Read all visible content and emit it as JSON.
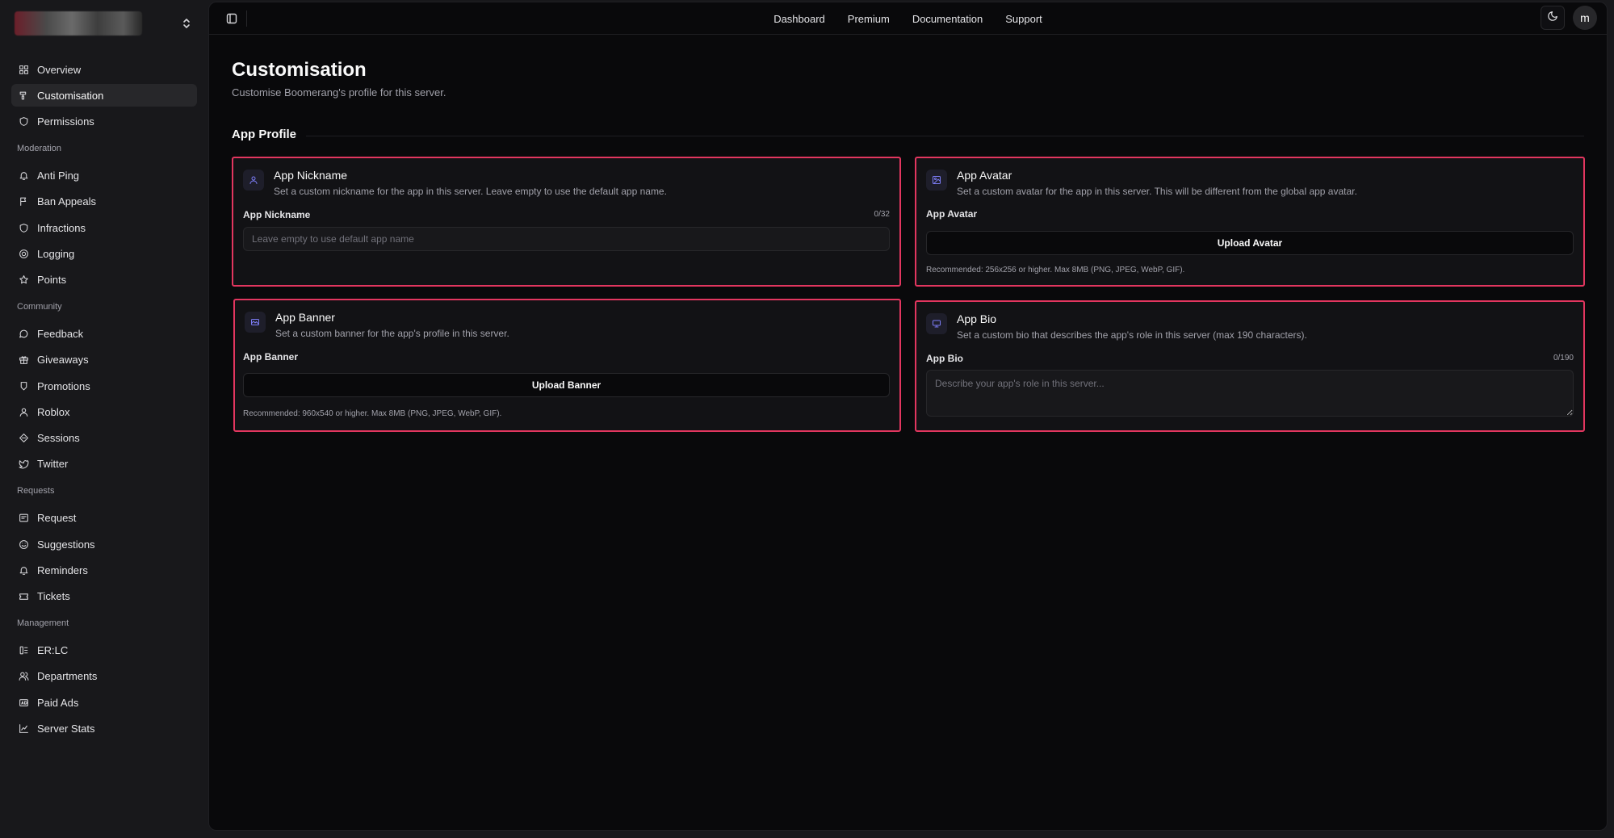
{
  "sidebar": {
    "top_items": [
      {
        "label": "Overview",
        "icon": "grid-icon",
        "active": false
      },
      {
        "label": "Customisation",
        "icon": "brush-icon",
        "active": true
      },
      {
        "label": "Permissions",
        "icon": "shield-icon",
        "active": false
      }
    ],
    "groups": [
      {
        "label": "Moderation",
        "items": [
          {
            "label": "Anti Ping",
            "icon": "bell-icon"
          },
          {
            "label": "Ban Appeals",
            "icon": "flag-icon"
          },
          {
            "label": "Infractions",
            "icon": "shield-icon"
          },
          {
            "label": "Logging",
            "icon": "target-icon"
          },
          {
            "label": "Points",
            "icon": "star-icon"
          }
        ]
      },
      {
        "label": "Community",
        "items": [
          {
            "label": "Feedback",
            "icon": "message-icon"
          },
          {
            "label": "Giveaways",
            "icon": "gift-icon"
          },
          {
            "label": "Promotions",
            "icon": "badge-icon"
          },
          {
            "label": "Roblox",
            "icon": "user-icon"
          },
          {
            "label": "Sessions",
            "icon": "diamond-icon"
          },
          {
            "label": "Twitter",
            "icon": "twitter-icon"
          }
        ]
      },
      {
        "label": "Requests",
        "items": [
          {
            "label": "Request",
            "icon": "inbox-icon"
          },
          {
            "label": "Suggestions",
            "icon": "smile-icon"
          },
          {
            "label": "Reminders",
            "icon": "bell-icon"
          },
          {
            "label": "Tickets",
            "icon": "ticket-icon"
          }
        ]
      },
      {
        "label": "Management",
        "items": [
          {
            "label": "ER:LC",
            "icon": "car-icon"
          },
          {
            "label": "Departments",
            "icon": "users-icon"
          },
          {
            "label": "Paid Ads",
            "icon": "ad-icon"
          },
          {
            "label": "Server Stats",
            "icon": "chart-icon"
          }
        ]
      }
    ]
  },
  "topnav": {
    "links": [
      "Dashboard",
      "Premium",
      "Documentation",
      "Support"
    ],
    "avatar_letter": "m"
  },
  "page": {
    "title": "Customisation",
    "subtitle": "Customise Boomerang's profile for this server.",
    "section_title": "App Profile"
  },
  "cards": {
    "nickname": {
      "title": "App Nickname",
      "description": "Set a custom nickname for the app in this server. Leave empty to use the default app name.",
      "field_label": "App Nickname",
      "count": "0/32",
      "placeholder": "Leave empty to use default app name"
    },
    "avatar": {
      "title": "App Avatar",
      "description": "Set a custom avatar for the app in this server. This will be different from the global app avatar.",
      "field_label": "App Avatar",
      "button_label": "Upload Avatar",
      "hint": "Recommended: 256x256 or higher. Max 8MB (PNG, JPEG, WebP, GIF)."
    },
    "banner": {
      "title": "App Banner",
      "description": "Set a custom banner for the app's profile in this server.",
      "field_label": "App Banner",
      "button_label": "Upload Banner",
      "hint": "Recommended: 960x540 or higher. Max 8MB (PNG, JPEG, WebP, GIF)."
    },
    "bio": {
      "title": "App Bio",
      "description": "Set a custom bio that describes the app's role in this server (max 190 characters).",
      "field_label": "App Bio",
      "count": "0/190",
      "placeholder": "Describe your app's role in this server..."
    }
  },
  "colors": {
    "highlight_border": "#e2365f",
    "accent_icon": "#7c7cf5",
    "background": "#09090b",
    "sidebar": "#18181b"
  }
}
